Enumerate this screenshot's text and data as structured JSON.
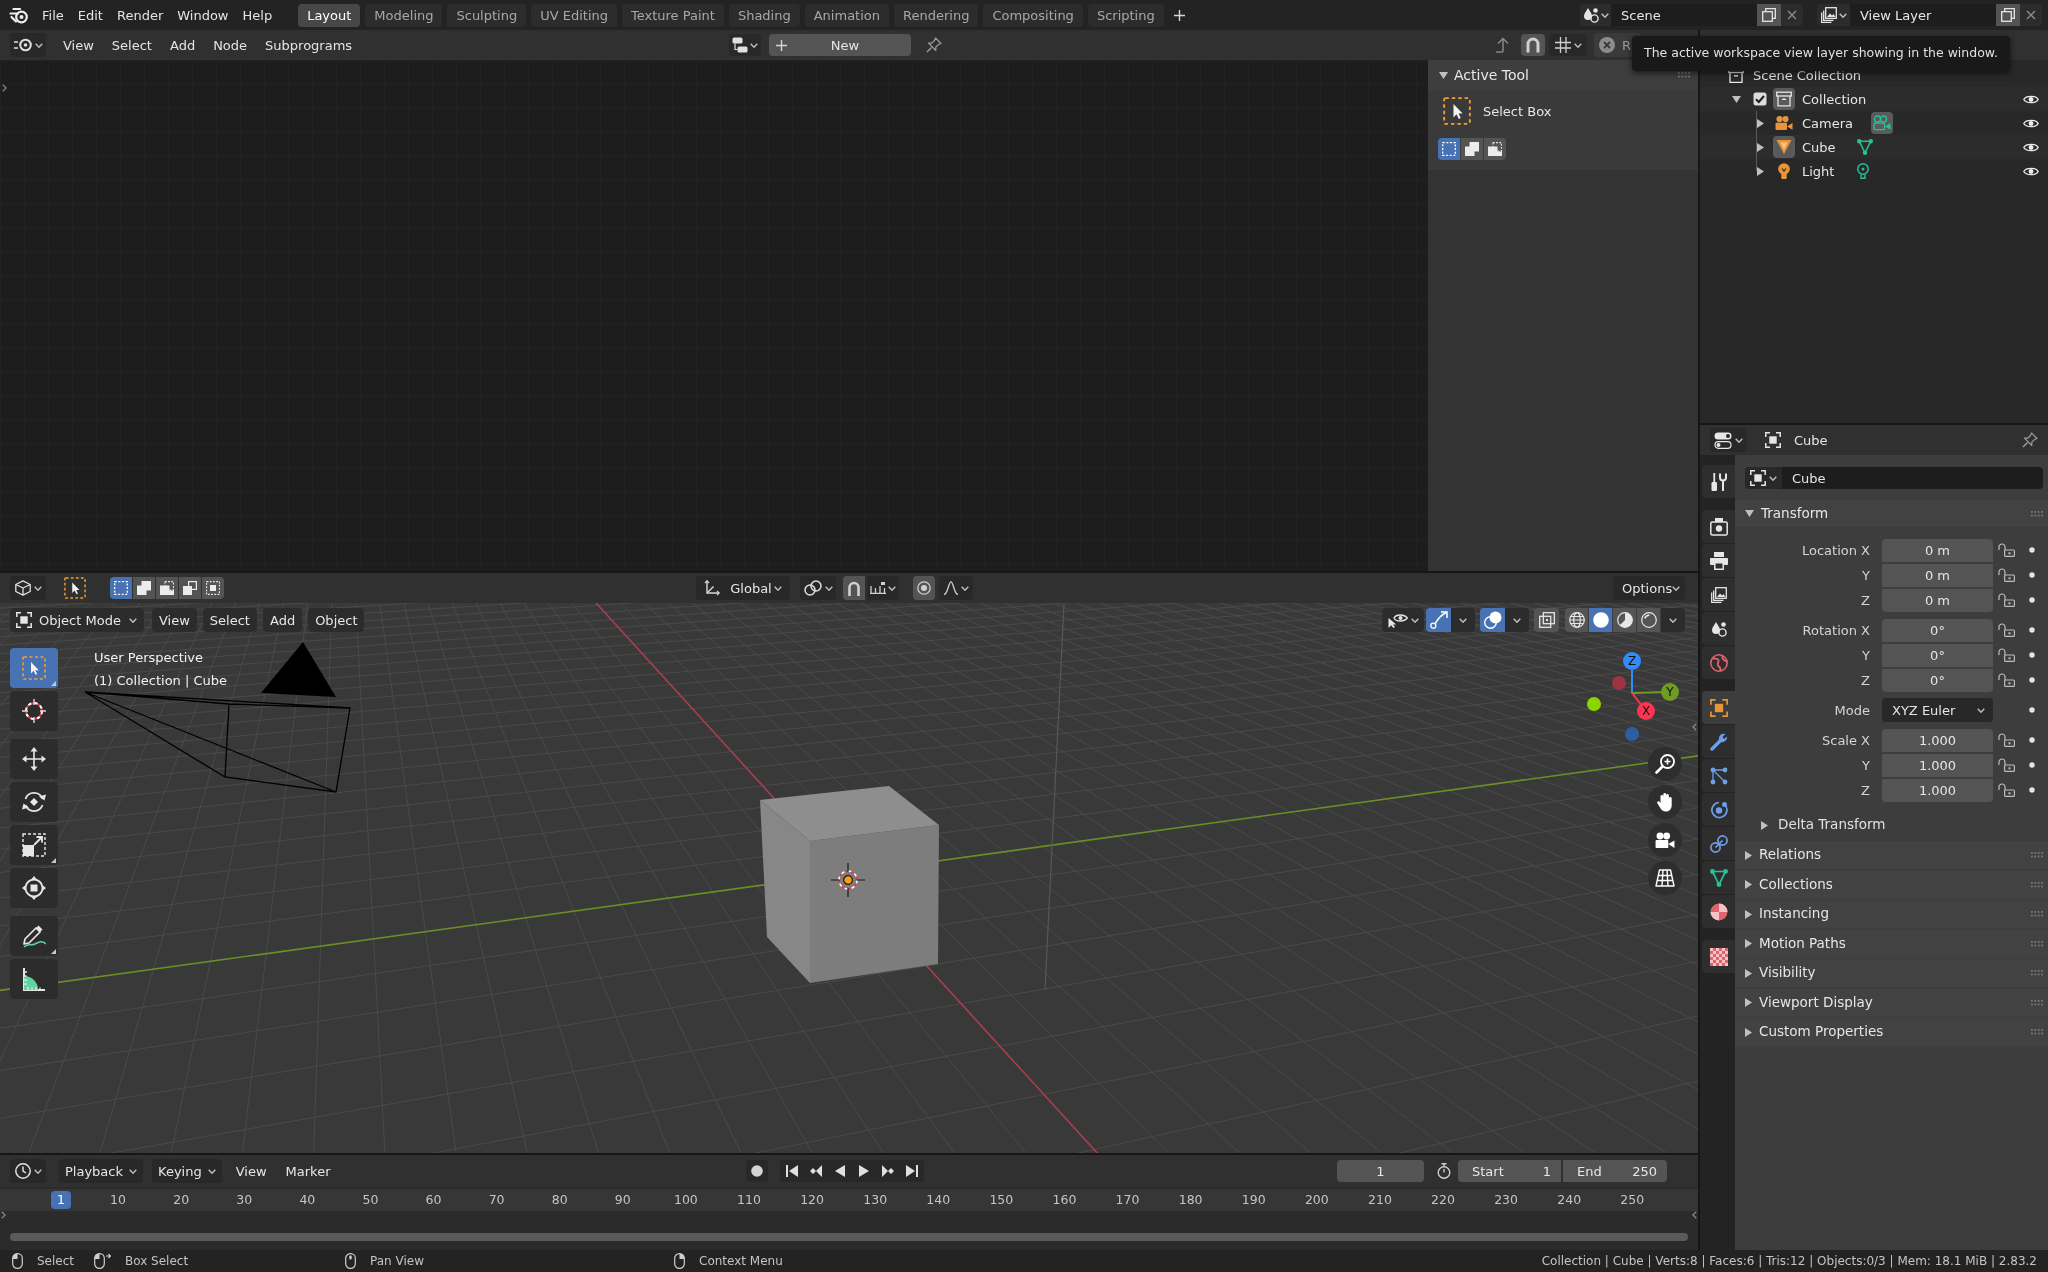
{
  "top_bar": {
    "menu": [
      "File",
      "Edit",
      "Render",
      "Window",
      "Help"
    ],
    "workspace_tabs": [
      {
        "label": "Layout",
        "selected": true
      },
      {
        "label": "Modeling",
        "selected": false
      },
      {
        "label": "Sculpting",
        "selected": false
      },
      {
        "label": "UV Editing",
        "selected": false
      },
      {
        "label": "Texture Paint",
        "selected": false
      },
      {
        "label": "Shading",
        "selected": false
      },
      {
        "label": "Animation",
        "selected": false
      },
      {
        "label": "Rendering",
        "selected": false
      },
      {
        "label": "Compositing",
        "selected": false
      },
      {
        "label": "Scripting",
        "selected": false
      }
    ],
    "scene": "Scene",
    "view_layer": "View Layer"
  },
  "node_editor": {
    "menu": [
      "View",
      "Select",
      "Add",
      "Node",
      "Subprograms"
    ],
    "new_button": "New",
    "header_cut_label": "R",
    "sidebar": {
      "panel_title": "Active Tool",
      "panel_expanded": true,
      "tool": "Select Box",
      "selection_modes": [
        {
          "kind": "set",
          "selected": true
        },
        {
          "kind": "extend",
          "selected": false
        },
        {
          "kind": "subtract",
          "selected": false
        }
      ]
    }
  },
  "tooltip": "The active workspace view layer showing in the window.",
  "outliner": {
    "tree": [
      {
        "label": "Scene Collection",
        "kind": "scene_collection",
        "children": [
          {
            "label": "Collection",
            "kind": "collection",
            "expanded": true,
            "checked": true,
            "active": true,
            "visible": true,
            "children": [
              {
                "label": "Camera",
                "kind": "camera",
                "expanded": false,
                "active": false,
                "data_active": true,
                "visible": true
              },
              {
                "label": "Cube",
                "kind": "mesh",
                "expanded": false,
                "active": true,
                "data_active": false,
                "visible": true
              },
              {
                "label": "Light",
                "kind": "light",
                "expanded": false,
                "active": false,
                "data_active": false,
                "visible": true
              }
            ]
          }
        ]
      }
    ]
  },
  "viewport": {
    "selection_modes": [
      {
        "kind": "set",
        "selected": true
      },
      {
        "kind": "extend",
        "selected": false
      },
      {
        "kind": "subtract",
        "selected": false
      },
      {
        "kind": "difference",
        "selected": false
      },
      {
        "kind": "intersect",
        "selected": false
      }
    ],
    "orientation": "Global",
    "options": "Options",
    "mode": "Object Mode",
    "menu": [
      "View",
      "Select",
      "Add",
      "Object"
    ],
    "gizmos_on": true,
    "overlays_on": true,
    "xray_on": false,
    "shading_modes": [
      {
        "kind": "wireframe",
        "selected": false
      },
      {
        "kind": "solid",
        "selected": true
      },
      {
        "kind": "material",
        "selected": false
      },
      {
        "kind": "rendered",
        "selected": false
      }
    ],
    "tool_groups": [
      [
        {
          "kind": "select_box",
          "selected": true,
          "has_variants": true
        },
        {
          "kind": "cursor",
          "selected": false,
          "has_variants": false
        }
      ],
      [
        {
          "kind": "move",
          "selected": false,
          "has_variants": false
        },
        {
          "kind": "rotate",
          "selected": false,
          "has_variants": false
        },
        {
          "kind": "scale",
          "selected": false,
          "has_variants": true
        },
        {
          "kind": "transform",
          "selected": false,
          "has_variants": false
        }
      ],
      [
        {
          "kind": "annotate",
          "selected": false,
          "has_variants": true
        },
        {
          "kind": "measure",
          "selected": false,
          "has_variants": false
        }
      ]
    ],
    "overlay_text": [
      "User Perspective",
      "(1) Collection | Cube"
    ],
    "axes": [
      {
        "label": "Z",
        "color": "#2f8cff"
      },
      {
        "label": "Y",
        "color": "#6f9a25"
      },
      {
        "label": "X",
        "color": "#ff3352"
      }
    ]
  },
  "properties": {
    "title": "Cube",
    "tab_groups": [
      [
        {
          "kind": "tool",
          "selected": false
        }
      ],
      [
        {
          "kind": "render",
          "selected": false
        },
        {
          "kind": "output",
          "selected": false
        },
        {
          "kind": "view_layer",
          "selected": false
        },
        {
          "kind": "scene",
          "selected": false
        },
        {
          "kind": "world",
          "selected": false
        }
      ],
      [
        {
          "kind": "object",
          "selected": true
        },
        {
          "kind": "modifiers",
          "selected": false
        },
        {
          "kind": "particles",
          "selected": false
        },
        {
          "kind": "physics",
          "selected": false
        },
        {
          "kind": "constraints",
          "selected": false
        },
        {
          "kind": "data",
          "selected": false
        },
        {
          "kind": "material",
          "selected": false
        }
      ],
      [
        {
          "kind": "texture",
          "selected": false
        }
      ]
    ],
    "object_name": "Cube",
    "transform": {
      "title": "Transform",
      "expanded": true,
      "groups": [
        {
          "kind": "vector",
          "rows": [
            {
              "label": "Location X",
              "value": "0 m"
            },
            {
              "label": "Y",
              "value": "0 m"
            },
            {
              "label": "Z",
              "value": "0 m"
            }
          ]
        },
        {
          "kind": "vector",
          "rows": [
            {
              "label": "Rotation X",
              "value": "0°"
            },
            {
              "label": "Y",
              "value": "0°"
            },
            {
              "label": "Z",
              "value": "0°"
            }
          ]
        },
        {
          "kind": "dropdown",
          "rows": [
            {
              "label": "Mode",
              "value": "XYZ Euler"
            }
          ]
        },
        {
          "kind": "vector",
          "rows": [
            {
              "label": "Scale X",
              "value": "1.000"
            },
            {
              "label": "Y",
              "value": "1.000"
            },
            {
              "label": "Z",
              "value": "1.000"
            }
          ]
        }
      ],
      "subpanels": [
        {
          "title": "Delta Transform",
          "expanded": false
        }
      ]
    },
    "panels": [
      {
        "title": "Relations",
        "expanded": false
      },
      {
        "title": "Collections",
        "expanded": false
      },
      {
        "title": "Instancing",
        "expanded": false
      },
      {
        "title": "Motion Paths",
        "expanded": false
      },
      {
        "title": "Visibility",
        "expanded": false
      },
      {
        "title": "Viewport Display",
        "expanded": false
      },
      {
        "title": "Custom Properties",
        "expanded": false
      }
    ]
  },
  "timeline": {
    "menus": [
      {
        "label": "Playback",
        "kind": "dropdown"
      },
      {
        "label": "Keying",
        "kind": "dropdown"
      },
      {
        "label": "View",
        "kind": "menu"
      },
      {
        "label": "Marker",
        "kind": "menu"
      }
    ],
    "current_frame": "1",
    "start": {
      "label": "Start",
      "value": "1"
    },
    "end": {
      "label": "End",
      "value": "250"
    },
    "frame_indicator": "1",
    "ruler_labels": [
      "10",
      "20",
      "30",
      "40",
      "50",
      "60",
      "70",
      "80",
      "90",
      "100",
      "110",
      "120",
      "130",
      "140",
      "150",
      "160",
      "170",
      "180",
      "190",
      "200",
      "210",
      "220",
      "230",
      "240",
      "250"
    ]
  },
  "status_bar": {
    "hints": [
      {
        "kind": "left_click",
        "label": "Select"
      },
      {
        "kind": "left_drag",
        "label": "Box Select"
      },
      {
        "kind": "middle_click",
        "label": "Pan View"
      },
      {
        "kind": "right_click",
        "label": "Context Menu"
      }
    ],
    "stats": "Collection | Cube | Verts:8 | Faces:6 | Tris:12 | Objects:0/3 | Mem: 18.1 MiB | 2.83.2"
  }
}
